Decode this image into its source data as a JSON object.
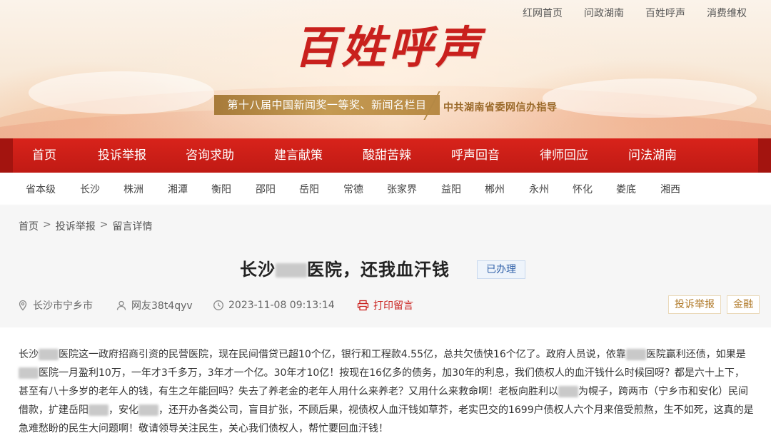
{
  "top_links": [
    "红网首页",
    "问政湖南",
    "百姓呼声",
    "消费维权"
  ],
  "logo_text": "百姓呼声",
  "award": "第十八届中国新闻奖一等奖、新闻名栏目",
  "guide": "中共湖南省委网信办指导",
  "nav": [
    "首页",
    "投诉举报",
    "咨询求助",
    "建言献策",
    "酸甜苦辣",
    "呼声回音",
    "律师回应",
    "问法湖南"
  ],
  "regions": [
    "省本级",
    "长沙",
    "株洲",
    "湘潭",
    "衡阳",
    "邵阳",
    "岳阳",
    "常德",
    "张家界",
    "益阳",
    "郴州",
    "永州",
    "怀化",
    "娄底",
    "湘西"
  ],
  "breadcrumb": [
    "首页",
    "投诉举报",
    "留言详情"
  ],
  "breadcrumb_sep": ">",
  "title": {
    "prefix": "长沙",
    "suffix": "医院，还我血汗钱"
  },
  "status": "已办理",
  "meta": {
    "location": "长沙市宁乡市",
    "user": "网友38t4qyv",
    "datetime": "2023-11-08 09:13:14",
    "print": "打印留言"
  },
  "tags": [
    "投诉举报",
    "金融"
  ],
  "body": [
    "长沙",
    "医院这一政府招商引资的民营医院，现在民间借贷已超10个亿，银行和工程款4.55亿，总共欠债快16个亿了。政府人员说，依靠",
    "医院赢利还债，如果是",
    "医院一月盈利10万，一年才3千多万，3年才一个亿。30年才10亿！按现在16亿多的债务，加30年的利息，我们债权人的血汗钱什么时候回呀？都是六十上下，甚至有八十多岁的老年人的钱，有生之年能回吗？失去了养老金的老年人用什么来养老？又用什么来救命啊！老板向胜利以",
    "为幌子，跨两市（宁乡市和安化）民间借款，扩建岳阳",
    "，安化",
    "，还开办各类公司，盲目扩张，不顾后果，视债权人血汗钱如草芥，老实巴交的1699户债权人六个月来倍受煎熬，生不如死，这真的是急难愁盼的民生大问题啊！敬请领导关注民生，关心我们债权人，帮忙要回血汗钱！"
  ]
}
